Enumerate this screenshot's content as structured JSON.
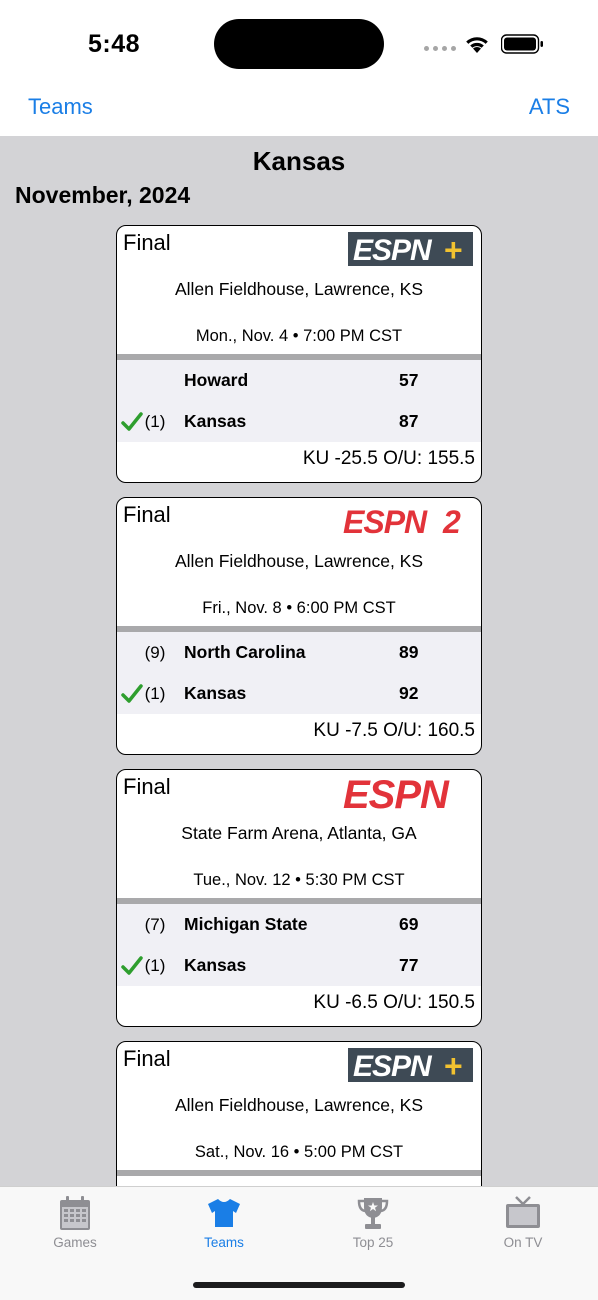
{
  "status_bar": {
    "time": "5:48"
  },
  "nav": {
    "left_label": "Teams",
    "right_label": "ATS"
  },
  "team_title": "Kansas",
  "month_header": "November, 2024",
  "games": [
    {
      "status": "Final",
      "network": "ESPN+",
      "venue": "Allen Fieldhouse, Lawrence, KS",
      "datetime": "Mon., Nov. 4 • 7:00 PM CST",
      "teams": [
        {
          "rank": "",
          "name": "Howard",
          "score": "57",
          "winner": false
        },
        {
          "rank": "(1)",
          "name": "Kansas",
          "score": "87",
          "winner": true
        }
      ],
      "line": "KU -25.5 O/U: 155.5"
    },
    {
      "status": "Final",
      "network": "ESPN 2",
      "venue": "Allen Fieldhouse, Lawrence, KS",
      "datetime": "Fri., Nov. 8 • 6:00 PM CST",
      "teams": [
        {
          "rank": "(9)",
          "name": "North Carolina",
          "score": "89",
          "winner": false
        },
        {
          "rank": "(1)",
          "name": "Kansas",
          "score": "92",
          "winner": true
        }
      ],
      "line": "KU -7.5 O/U: 160.5"
    },
    {
      "status": "Final",
      "network": "ESPN",
      "venue": "State Farm Arena, Atlanta, GA",
      "datetime": "Tue., Nov. 12 • 5:30 PM CST",
      "teams": [
        {
          "rank": "(7)",
          "name": "Michigan State",
          "score": "69",
          "winner": false
        },
        {
          "rank": "(1)",
          "name": "Kansas",
          "score": "77",
          "winner": true
        }
      ],
      "line": "KU -6.5 O/U: 150.5"
    },
    {
      "status": "Final",
      "network": "ESPN+",
      "venue": "Allen Fieldhouse, Lawrence, KS",
      "datetime": "Sat., Nov. 16 • 5:00 PM CST",
      "teams": [],
      "line": ""
    }
  ],
  "tabs": [
    {
      "label": "Games",
      "icon": "calendar-icon",
      "active": false
    },
    {
      "label": "Teams",
      "icon": "jersey-icon",
      "active": true
    },
    {
      "label": "Top 25",
      "icon": "trophy-icon",
      "active": false
    },
    {
      "label": "On TV",
      "icon": "tv-icon",
      "active": false
    }
  ],
  "colors": {
    "accent": "#1a7ee6",
    "espn_red": "#e2333a",
    "espn_plus_bg": "#3e4a55",
    "espn_plus_yellow": "#f2c230",
    "win_check": "#2e9e2e",
    "content_bg": "#d3d3d6"
  }
}
